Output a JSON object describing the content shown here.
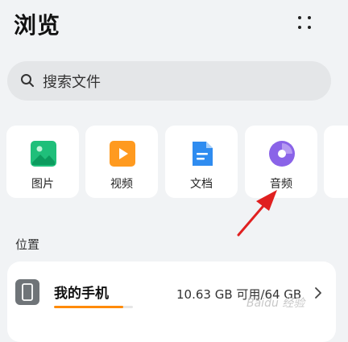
{
  "header": {
    "title": "浏览",
    "more_icon": "more-grid-icon"
  },
  "search": {
    "placeholder": "搜索文件",
    "icon": "search-icon"
  },
  "categories": [
    {
      "label": "图片",
      "icon": "image-icon",
      "color": "#1fbf7a"
    },
    {
      "label": "视频",
      "icon": "video-icon",
      "color": "#ff9a1f"
    },
    {
      "label": "文档",
      "icon": "document-icon",
      "color": "#2f8cf0"
    },
    {
      "label": "音频",
      "icon": "audio-icon",
      "color": "#8a63e8"
    }
  ],
  "location": {
    "section_label": "位置",
    "device": {
      "name": "我的手机",
      "storage_text": "10.63 GB 可用/64 GB",
      "used_fraction": 0.88,
      "accent": "#ff8a00"
    }
  },
  "annotation": {
    "arrow_color": "#e02020"
  },
  "watermark": "Baidu 经验"
}
